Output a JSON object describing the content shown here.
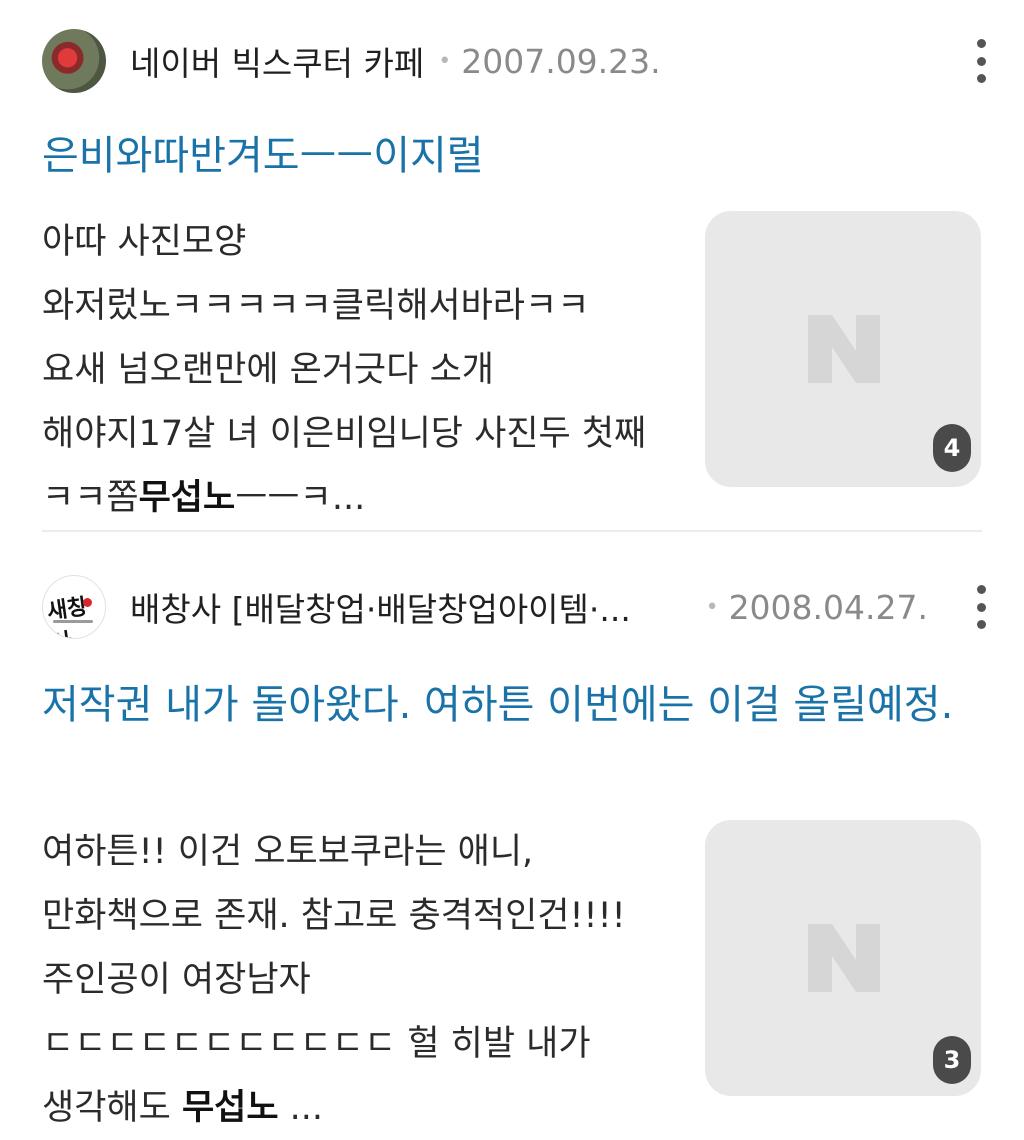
{
  "results": [
    {
      "source": "네이버 빅스쿠터 카페",
      "separator": "•",
      "date": "2007.09.23.",
      "title": "은비와따반겨도ㅡㅡ이지럴",
      "snippet_before": "아따 사진모양 와저렀노ㅋㅋㅋㅋㅋ클릭해서바라ㅋㅋ 요새 넘오랜만에 온거긋다 소개 해야지17살 녀 이은비임니당 사진두 첫째 ㅋㅋ쫌",
      "snippet_bold": "무섭노",
      "snippet_after": "ㅡㅡㅋ...",
      "image_count": "4",
      "avatar_icon": "motorcycle-avatar-icon",
      "thumbnail_icon": "naver-n-placeholder-icon"
    },
    {
      "source": "배창사 [배달창업·배달창업아이템·...",
      "separator": "•",
      "date": "2008.04.27.",
      "title": "저작권 내가 돌아왔다. 여하튼 이번에는 이걸 올릴예정.",
      "snippet_before": "여하튼!! 이건 오토보쿠라는 애니,만화책으로 존재. 참고로 충격적인건!!!! 주인공이 여장남자 ㄷㄷㄷㄷㄷㄷㄷㄷㄷㄷㄷ 헐 히발 내가 생각해도 ",
      "snippet_bold": "무섭노",
      "snippet_after": " ...",
      "image_count": "3",
      "avatar_text": "새창사",
      "thumbnail_icon": "naver-n-placeholder-icon"
    }
  ],
  "colors": {
    "title": "#1a73a8",
    "date": "#8a8a8a",
    "placeholder_bg": "#e8e8e8",
    "placeholder_logo": "#d6d6d6",
    "badge_bg": "#4a4a4a"
  }
}
